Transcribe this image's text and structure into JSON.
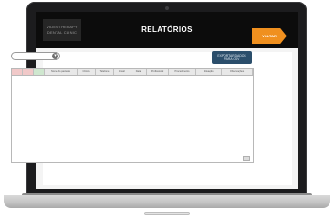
{
  "header": {
    "brand_line1": "VIDEOTHERAPY",
    "brand_line2": "DENTAL CLINIC",
    "title": "RELATÓRIOS",
    "back_label": "VOLTAR"
  },
  "toolbar": {
    "select_value": "",
    "export_line1": "EXPORTAR DADOS",
    "export_line2": "PARA CSV"
  },
  "table": {
    "columns": [
      "",
      "",
      "",
      "Nome do paciente",
      "Clínica",
      "Telefone",
      "Email",
      "Data",
      "Profissional",
      "Procedimento",
      "Situação",
      "Observações"
    ]
  },
  "colors": {
    "back_button": "#f0901f",
    "export_button": "#2b4e6b",
    "topbar": "#0c0c0c"
  }
}
